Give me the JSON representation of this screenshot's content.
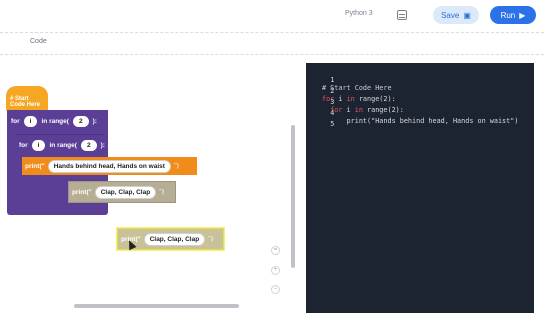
{
  "header": {
    "language": "Python 3",
    "save_label": "Save",
    "run_label": "Run",
    "notes_icon": "notes-icon",
    "save_icon": "save-icon",
    "run_icon": "play-icon"
  },
  "section": {
    "label": "Code"
  },
  "blocks": {
    "hat_label": "# Start Code Here",
    "for_label": "for",
    "in_range_label": "in range(",
    "close_label": "):",
    "var_name": "i",
    "outer_count": "2",
    "inner_count": "2",
    "print_label": "print(\"",
    "print_close": "\")",
    "print1_text": "Hands behind head, Hands on waist",
    "print2_text": "Clap, Clap, Clap",
    "print3_text": "Clap, Clap, Clap"
  },
  "editor": {
    "lines": [
      {
        "num": "1",
        "text": "# Start Code Here"
      },
      {
        "num": "2",
        "kw": "for",
        "var": " i ",
        "kw2": "in",
        "rest": " range(2):"
      },
      {
        "num": "3",
        "indent": "  ",
        "kw": "for",
        "var": " i ",
        "kw2": "in",
        "rest": " range(2):"
      },
      {
        "num": "4",
        "text": "      print(\"Hands behind head, Hands on waist\")"
      },
      {
        "num": "5",
        "text": ""
      }
    ]
  },
  "colors": {
    "run_button": "#2b72e8",
    "save_button": "#dbe9fb",
    "hat_block": "#f5a623",
    "loop_block": "#5b3f96",
    "print_block": "#f18b1c",
    "editor_bg": "#1c2431",
    "keyword": "#e3556a"
  }
}
